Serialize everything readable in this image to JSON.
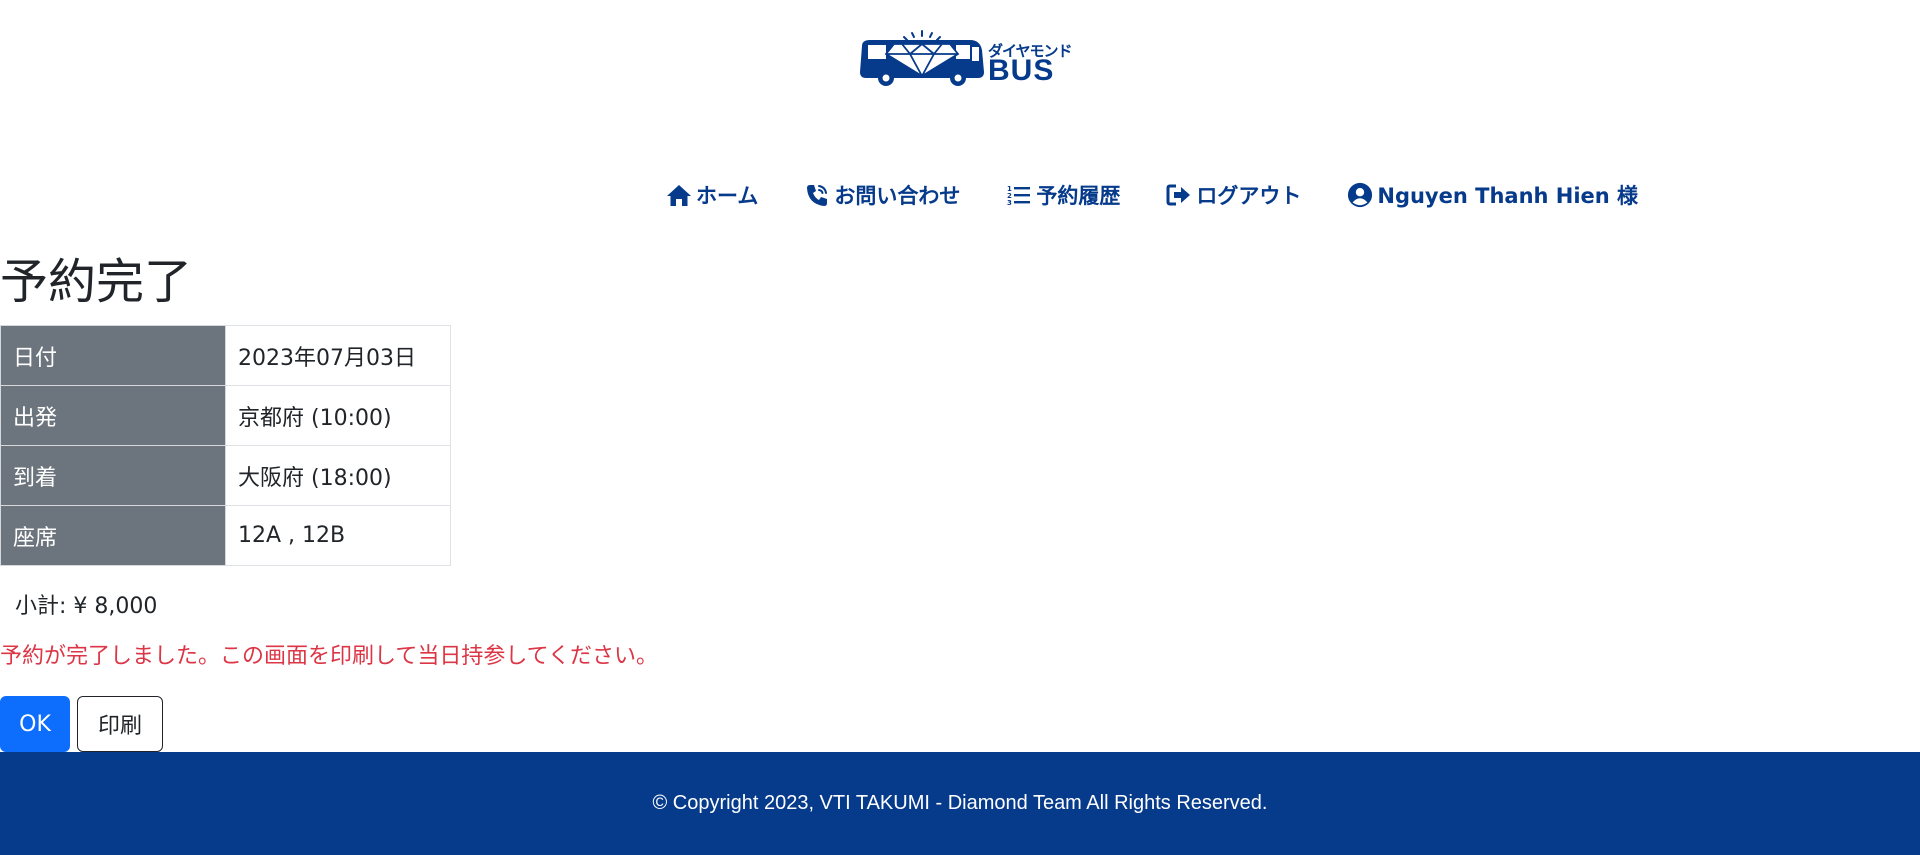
{
  "brand": {
    "logo_kana": "ダイヤモンド",
    "logo_text": "BUS",
    "logo_icon": "diamond-bus-icon",
    "color": "#063a8b"
  },
  "nav": {
    "items": [
      {
        "label": "ホーム",
        "icon": "home-icon"
      },
      {
        "label": "お問い合わせ",
        "icon": "phone-icon"
      },
      {
        "label": "予約履歴",
        "icon": "list-ordered-icon"
      },
      {
        "label": "ログアウト",
        "icon": "logout-icon"
      },
      {
        "label": "Nguyen Thanh Hien 様",
        "icon": "user-circle-icon"
      }
    ]
  },
  "main": {
    "title": "予約完了",
    "rows": [
      {
        "label": "日付",
        "value": "2023年07月03日"
      },
      {
        "label": "出発",
        "value": "京都府 (10:00)"
      },
      {
        "label": "到着",
        "value": "大阪府 (18:00)"
      },
      {
        "label": "座席",
        "value": "12A , 12B"
      }
    ],
    "subtotal": "小計: ¥ 8,000",
    "message": "予約が完了しました。この画面を印刷して当日持参してください。",
    "ok_label": "OK",
    "print_label": "印刷"
  },
  "footer": {
    "text": "© Copyright 2023, VTI TAKUMI - Diamond Team All Rights Reserved."
  },
  "colors": {
    "primary": "#063a8b",
    "button_primary": "#0d6efd",
    "label_bg": "#6c757d",
    "message": "#dc3545"
  }
}
